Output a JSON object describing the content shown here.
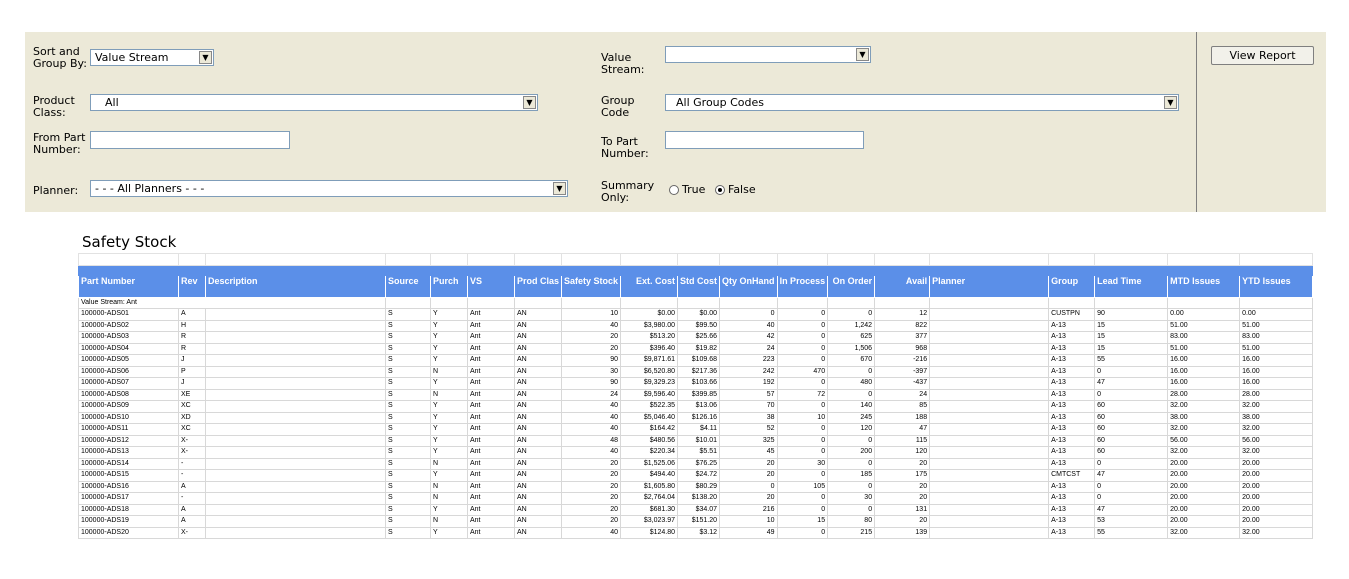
{
  "params": {
    "sort_label": "Sort and Group By:",
    "sort_value": "Value Stream",
    "value_stream_label": "Value Stream:",
    "value_stream_value": "",
    "product_class_label": "Product Class:",
    "product_class_value": "All",
    "group_code_label": "Group Code",
    "group_code_value": "All Group Codes",
    "from_part_label": "From Part Number:",
    "to_part_label": "To Part Number:",
    "planner_label": "Planner:",
    "planner_value": "- - - All Planners - - -",
    "summary_label": "Summary Only:",
    "true_label": "True",
    "false_label": "False",
    "summary_selected": "False",
    "view_report_label": "View Report"
  },
  "report": {
    "title": "Safety Stock",
    "group_label": "Value Stream: Ant",
    "columns": [
      "Part Number",
      "Rev",
      "Description",
      "Source",
      "Purch",
      "VS",
      "Prod Clas",
      "Safety Stock",
      "Ext. Cost",
      "Std Cost",
      "Qty OnHand",
      "In Process",
      "On Order",
      "Avail",
      "Planner",
      "Group",
      "Lead Time",
      "MTD Issues",
      "YTD Issues"
    ],
    "rows": [
      [
        "100000-ADS01",
        "A",
        "",
        "S",
        "Y",
        "Ant",
        "AN",
        "10",
        "$0.00",
        "$0.00",
        "0",
        "0",
        "0",
        "12",
        "",
        "CUSTPN",
        "90",
        "0.00",
        "0.00"
      ],
      [
        "100000-ADS02",
        "H",
        "",
        "S",
        "Y",
        "Ant",
        "AN",
        "40",
        "$3,980.00",
        "$99.50",
        "40",
        "0",
        "1,242",
        "822",
        "",
        "A-13",
        "15",
        "51.00",
        "51.00"
      ],
      [
        "100000-ADS03",
        "R",
        "",
        "S",
        "Y",
        "Ant",
        "AN",
        "20",
        "$513.20",
        "$25.66",
        "42",
        "0",
        "625",
        "377",
        "",
        "A-13",
        "15",
        "83.00",
        "83.00"
      ],
      [
        "100000-ADS04",
        "R",
        "",
        "S",
        "Y",
        "Ant",
        "AN",
        "20",
        "$396.40",
        "$19.82",
        "24",
        "0",
        "1,506",
        "968",
        "",
        "A-13",
        "15",
        "51.00",
        "51.00"
      ],
      [
        "100000-ADS05",
        "J",
        "",
        "S",
        "Y",
        "Ant",
        "AN",
        "90",
        "$9,871.61",
        "$109.68",
        "223",
        "0",
        "670",
        "-216",
        "",
        "A-13",
        "55",
        "16.00",
        "16.00"
      ],
      [
        "100000-ADS06",
        "P",
        "",
        "S",
        "N",
        "Ant",
        "AN",
        "30",
        "$6,520.80",
        "$217.36",
        "242",
        "470",
        "0",
        "-397",
        "",
        "A-13",
        "0",
        "16.00",
        "16.00"
      ],
      [
        "100000-ADS07",
        "J",
        "",
        "S",
        "Y",
        "Ant",
        "AN",
        "90",
        "$9,329.23",
        "$103.66",
        "192",
        "0",
        "480",
        "-437",
        "",
        "A-13",
        "47",
        "16.00",
        "16.00"
      ],
      [
        "100000-ADS08",
        "XE",
        "",
        "S",
        "N",
        "Ant",
        "AN",
        "24",
        "$9,596.40",
        "$399.85",
        "57",
        "72",
        "0",
        "24",
        "",
        "A-13",
        "0",
        "28.00",
        "28.00"
      ],
      [
        "100000-ADS09",
        "XC",
        "",
        "S",
        "Y",
        "Ant",
        "AN",
        "40",
        "$522.35",
        "$13.06",
        "70",
        "0",
        "140",
        "85",
        "",
        "A-13",
        "60",
        "32.00",
        "32.00"
      ],
      [
        "100000-ADS10",
        "XD",
        "",
        "S",
        "Y",
        "Ant",
        "AN",
        "40",
        "$5,046.40",
        "$126.16",
        "38",
        "10",
        "245",
        "188",
        "",
        "A-13",
        "60",
        "38.00",
        "38.00"
      ],
      [
        "100000-ADS11",
        "XC",
        "",
        "S",
        "Y",
        "Ant",
        "AN",
        "40",
        "$164.42",
        "$4.11",
        "52",
        "0",
        "120",
        "47",
        "",
        "A-13",
        "60",
        "32.00",
        "32.00"
      ],
      [
        "100000-ADS12",
        "X-",
        "",
        "S",
        "Y",
        "Ant",
        "AN",
        "48",
        "$480.56",
        "$10.01",
        "325",
        "0",
        "0",
        "115",
        "",
        "A-13",
        "60",
        "56.00",
        "56.00"
      ],
      [
        "100000-ADS13",
        "X-",
        "",
        "S",
        "Y",
        "Ant",
        "AN",
        "40",
        "$220.34",
        "$5.51",
        "45",
        "0",
        "200",
        "120",
        "",
        "A-13",
        "60",
        "32.00",
        "32.00"
      ],
      [
        "100000-ADS14",
        "-",
        "",
        "S",
        "N",
        "Ant",
        "AN",
        "20",
        "$1,525.06",
        "$76.25",
        "20",
        "30",
        "0",
        "20",
        "",
        "A-13",
        "0",
        "20.00",
        "20.00"
      ],
      [
        "100000-ADS15",
        "-",
        "",
        "S",
        "Y",
        "Ant",
        "AN",
        "20",
        "$494.40",
        "$24.72",
        "20",
        "0",
        "185",
        "175",
        "",
        "CMTCST",
        "47",
        "20.00",
        "20.00"
      ],
      [
        "100000-ADS16",
        "A",
        "",
        "S",
        "N",
        "Ant",
        "AN",
        "20",
        "$1,605.80",
        "$80.29",
        "0",
        "105",
        "0",
        "20",
        "",
        "A-13",
        "0",
        "20.00",
        "20.00"
      ],
      [
        "100000-ADS17",
        "-",
        "",
        "S",
        "N",
        "Ant",
        "AN",
        "20",
        "$2,764.04",
        "$138.20",
        "20",
        "0",
        "30",
        "20",
        "",
        "A-13",
        "0",
        "20.00",
        "20.00"
      ],
      [
        "100000-ADS18",
        "A",
        "",
        "S",
        "Y",
        "Ant",
        "AN",
        "20",
        "$681.30",
        "$34.07",
        "216",
        "0",
        "0",
        "131",
        "",
        "A-13",
        "47",
        "20.00",
        "20.00"
      ],
      [
        "100000-ADS19",
        "A",
        "",
        "S",
        "N",
        "Ant",
        "AN",
        "20",
        "$3,023.97",
        "$151.20",
        "10",
        "15",
        "80",
        "20",
        "",
        "A-13",
        "53",
        "20.00",
        "20.00"
      ],
      [
        "100000-ADS20",
        "X-",
        "",
        "S",
        "Y",
        "Ant",
        "AN",
        "40",
        "$124.80",
        "$3.12",
        "49",
        "0",
        "215",
        "139",
        "",
        "A-13",
        "55",
        "32.00",
        "32.00"
      ]
    ]
  }
}
